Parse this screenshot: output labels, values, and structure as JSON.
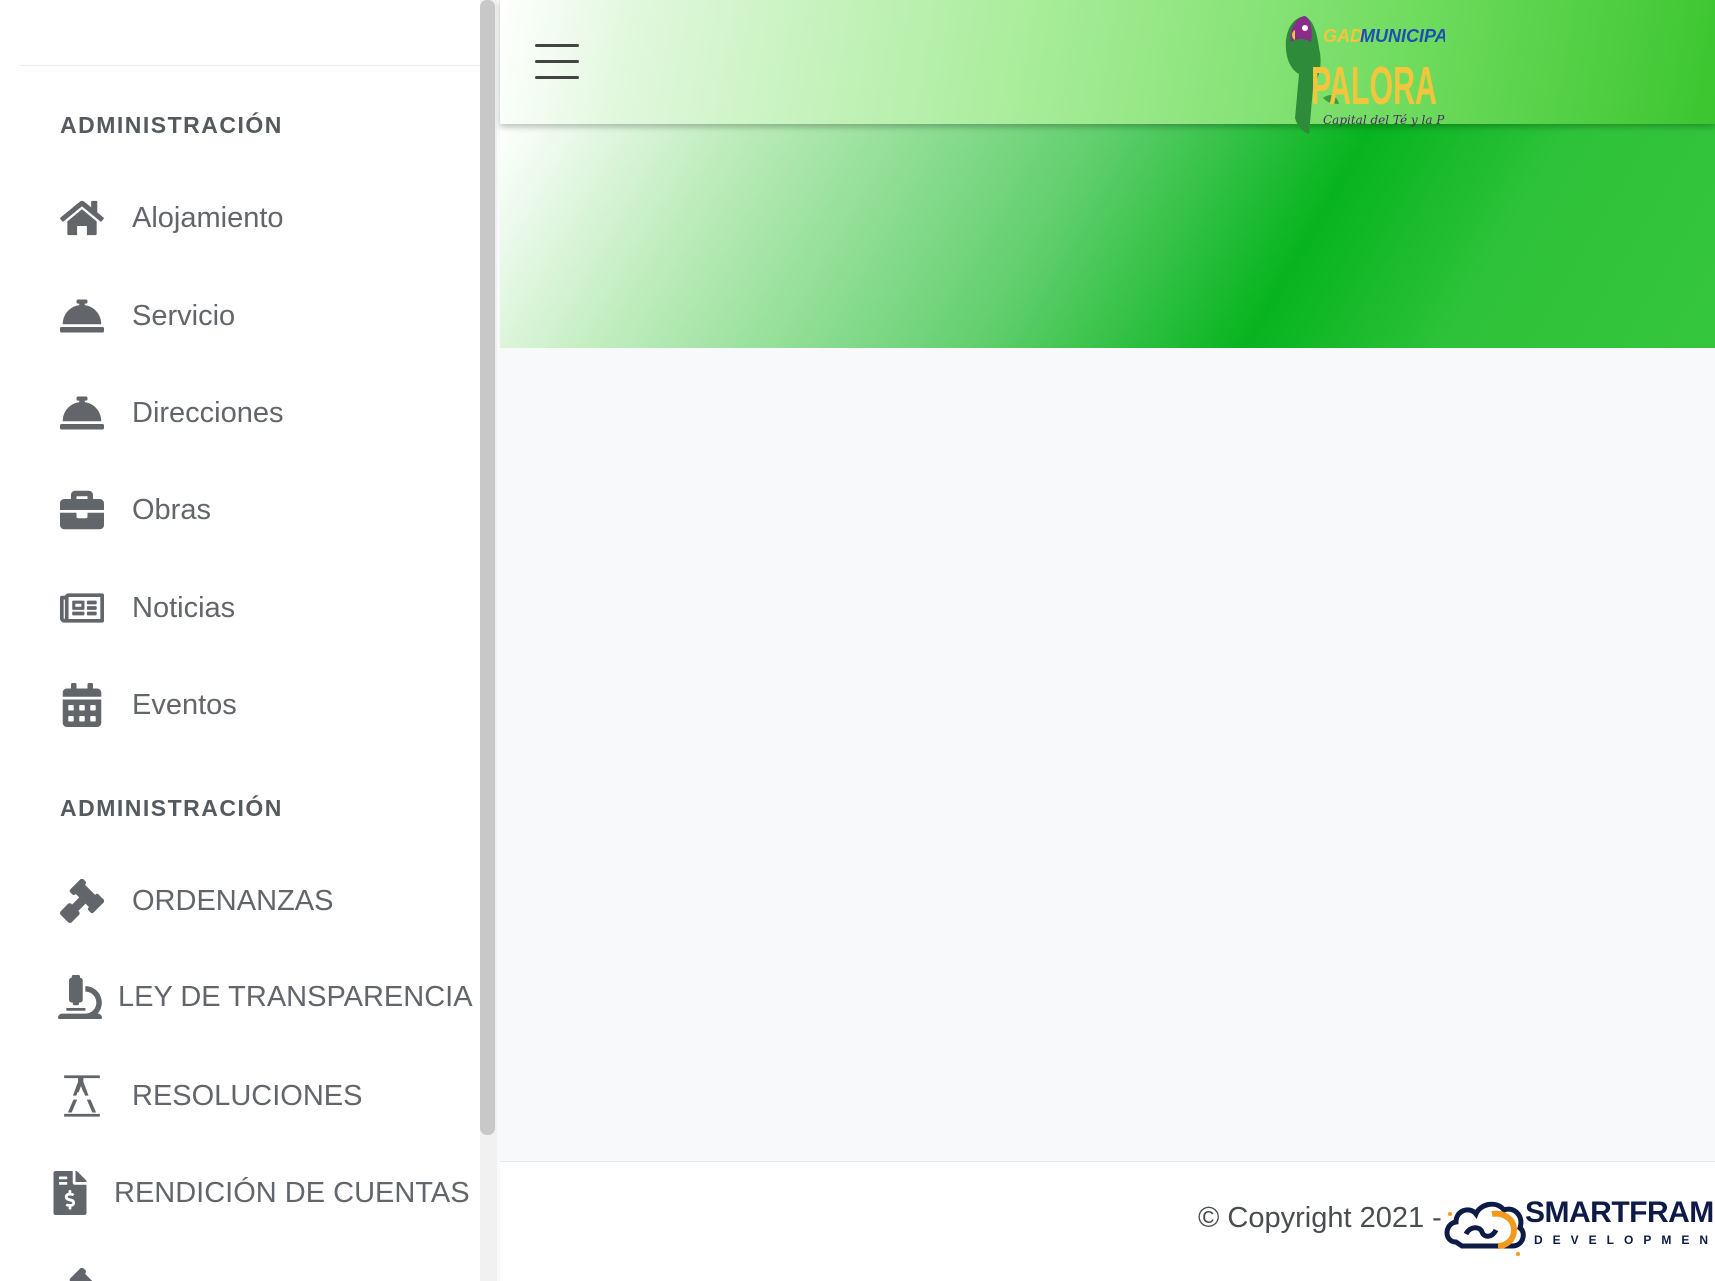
{
  "sidebar": {
    "section1_heading": "ADMINISTRACIÓN",
    "section1_items": [
      {
        "label": "Alojamiento",
        "icon": "home-icon"
      },
      {
        "label": "Servicio",
        "icon": "concierge-bell-icon"
      },
      {
        "label": "Direcciones",
        "icon": "concierge-bell-icon"
      },
      {
        "label": "Obras",
        "icon": "briefcase-icon"
      },
      {
        "label": "Noticias",
        "icon": "newspaper-icon"
      },
      {
        "label": "Eventos",
        "icon": "calendar-icon"
      }
    ],
    "section2_heading": "ADMINISTRACIÓN",
    "section2_items": [
      {
        "label": "ORDENANZAS",
        "icon": "gavel-icon"
      },
      {
        "label": "LEY DE TRANSPARENCIA",
        "icon": "microscope-icon"
      },
      {
        "label": "RESOLUCIONES",
        "icon": "drafting-compass-icon"
      },
      {
        "label": "RENDICIÓN DE CUENTAS",
        "icon": "invoice-dollar-icon"
      }
    ]
  },
  "header": {
    "logo": {
      "line1_a": "GAD",
      "line1_b": "MUNICIPAL",
      "line2": "PALORA",
      "tagline": "Capital del Té y la Pitahaya"
    }
  },
  "footer": {
    "copyright": "© Copyright 2021 -",
    "brand_name": "SMARTFRAM",
    "brand_sub": "DEVELOPMEN"
  },
  "colors": {
    "accent_green": "#07b41f",
    "sidebar_text": "#62666b",
    "brand_navy": "#0e1b47",
    "brand_orange": "#f39a1e"
  }
}
